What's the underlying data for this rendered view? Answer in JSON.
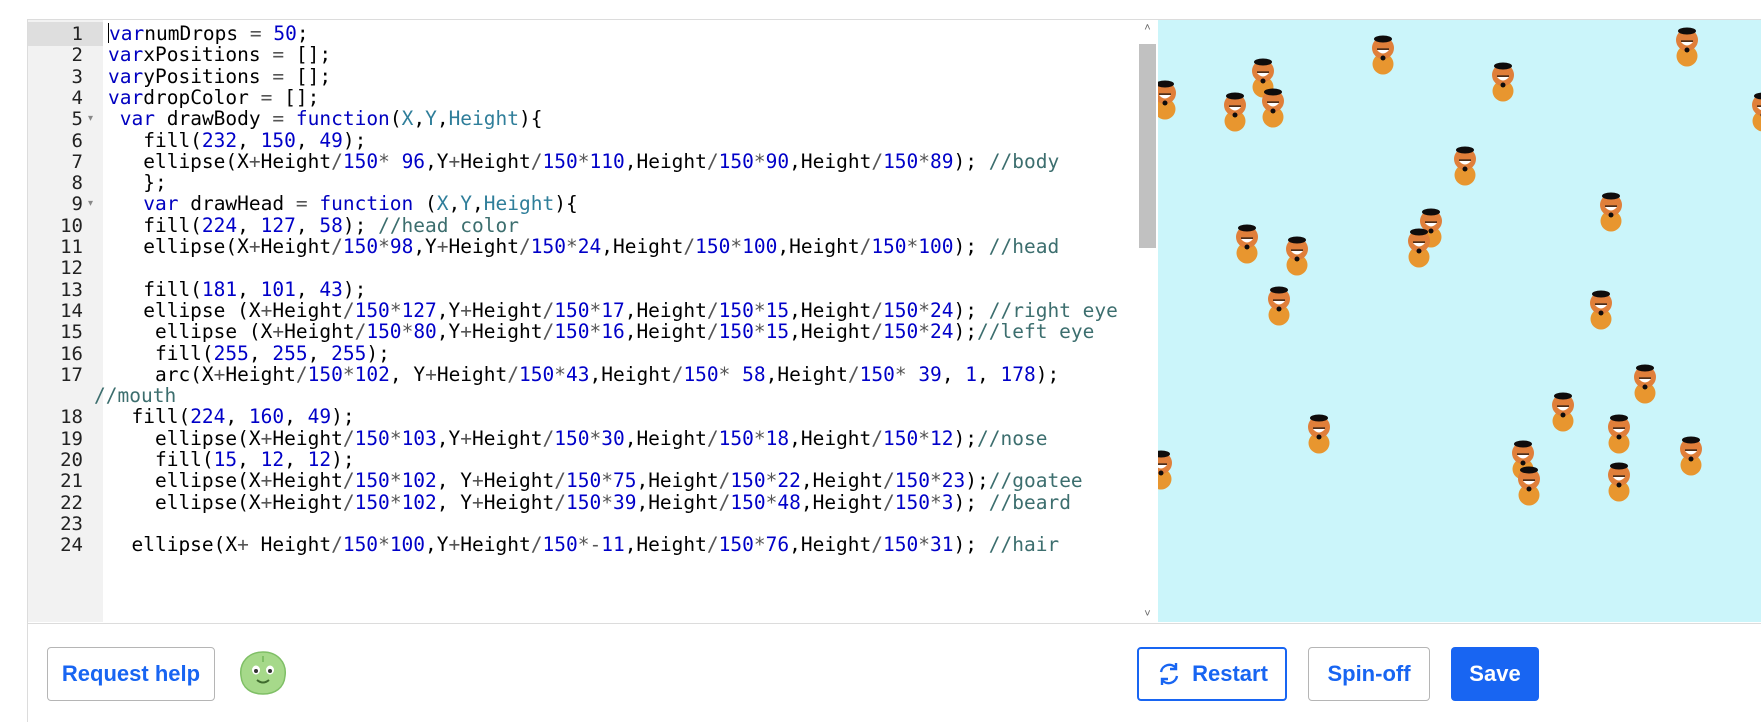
{
  "editor": {
    "line_numbers": [
      "1",
      "2",
      "3",
      "4",
      "5",
      "6",
      "7",
      "8",
      "9",
      "10",
      "11",
      "12",
      "13",
      "14",
      "15",
      "16",
      "17",
      "18",
      "19",
      "20",
      "21",
      "22",
      "23",
      "24"
    ],
    "lines": [
      [
        [
          "kw",
          "var"
        ],
        [
          "",
          "numDrops "
        ],
        [
          "op",
          "="
        ],
        [
          "num",
          " 50"
        ],
        [
          "",
          ";"
        ]
      ],
      [
        [
          "kw",
          "var"
        ],
        [
          "",
          "xPositions "
        ],
        [
          "op",
          "="
        ],
        [
          "",
          " [];"
        ]
      ],
      [
        [
          "kw",
          "var"
        ],
        [
          "",
          "yPositions "
        ],
        [
          "op",
          "="
        ],
        [
          "",
          " [];"
        ]
      ],
      [
        [
          "kw",
          "var"
        ],
        [
          "",
          "dropColor "
        ],
        [
          "op",
          "="
        ],
        [
          "",
          " [];"
        ]
      ],
      [
        [
          "",
          " "
        ],
        [
          "kw",
          "var"
        ],
        [
          "",
          " drawBody "
        ],
        [
          "op",
          "="
        ],
        [
          "kw",
          " function"
        ],
        [
          "",
          "("
        ],
        [
          "param",
          "X"
        ],
        [
          "",
          ","
        ],
        [
          "param",
          "Y"
        ],
        [
          "",
          ","
        ],
        [
          "param",
          "Height"
        ],
        [
          "",
          "){"
        ]
      ],
      [
        [
          "",
          "   fill("
        ],
        [
          "num",
          "232"
        ],
        [
          "",
          ", "
        ],
        [
          "num",
          "150"
        ],
        [
          "",
          ", "
        ],
        [
          "num",
          "49"
        ],
        [
          "",
          ");"
        ]
      ],
      [
        [
          "",
          "   ellipse(X"
        ],
        [
          "op",
          "+"
        ],
        [
          "",
          "Height"
        ],
        [
          "op",
          "/"
        ],
        [
          "num",
          "150"
        ],
        [
          "op",
          "*"
        ],
        [
          "num",
          " 96"
        ],
        [
          "",
          ",Y"
        ],
        [
          "op",
          "+"
        ],
        [
          "",
          "Height"
        ],
        [
          "op",
          "/"
        ],
        [
          "num",
          "150"
        ],
        [
          "op",
          "*"
        ],
        [
          "num",
          "110"
        ],
        [
          "",
          ",Height"
        ],
        [
          "op",
          "/"
        ],
        [
          "num",
          "150"
        ],
        [
          "op",
          "*"
        ],
        [
          "num",
          "90"
        ],
        [
          "",
          ",Height"
        ],
        [
          "op",
          "/"
        ],
        [
          "num",
          "150"
        ],
        [
          "op",
          "*"
        ],
        [
          "num",
          "89"
        ],
        [
          "",
          "); "
        ],
        [
          "cm",
          "//body"
        ]
      ],
      [
        [
          "",
          "   };"
        ]
      ],
      [
        [
          "",
          "   "
        ],
        [
          "kw",
          "var"
        ],
        [
          "",
          " drawHead "
        ],
        [
          "op",
          "="
        ],
        [
          "kw",
          " function"
        ],
        [
          "",
          " ("
        ],
        [
          "param",
          "X"
        ],
        [
          "",
          ","
        ],
        [
          "param",
          "Y"
        ],
        [
          "",
          ","
        ],
        [
          "param",
          "Height"
        ],
        [
          "",
          "){"
        ]
      ],
      [
        [
          "",
          "   fill("
        ],
        [
          "num",
          "224"
        ],
        [
          "",
          ", "
        ],
        [
          "num",
          "127"
        ],
        [
          "",
          ", "
        ],
        [
          "num",
          "58"
        ],
        [
          "",
          "); "
        ],
        [
          "cm",
          "//head color"
        ]
      ],
      [
        [
          "",
          "   ellipse(X"
        ],
        [
          "op",
          "+"
        ],
        [
          "",
          "Height"
        ],
        [
          "op",
          "/"
        ],
        [
          "num",
          "150"
        ],
        [
          "op",
          "*"
        ],
        [
          "num",
          "98"
        ],
        [
          "",
          ",Y"
        ],
        [
          "op",
          "+"
        ],
        [
          "",
          "Height"
        ],
        [
          "op",
          "/"
        ],
        [
          "num",
          "150"
        ],
        [
          "op",
          "*"
        ],
        [
          "num",
          "24"
        ],
        [
          "",
          ",Height"
        ],
        [
          "op",
          "/"
        ],
        [
          "num",
          "150"
        ],
        [
          "op",
          "*"
        ],
        [
          "num",
          "100"
        ],
        [
          "",
          ",Height"
        ],
        [
          "op",
          "/"
        ],
        [
          "num",
          "150"
        ],
        [
          "op",
          "*"
        ],
        [
          "num",
          "100"
        ],
        [
          "",
          "); "
        ],
        [
          "cm",
          "//head"
        ]
      ],
      [],
      [
        [
          "",
          "   fill("
        ],
        [
          "num",
          "181"
        ],
        [
          "",
          ", "
        ],
        [
          "num",
          "101"
        ],
        [
          "",
          ", "
        ],
        [
          "num",
          "43"
        ],
        [
          "",
          ");"
        ]
      ],
      [
        [
          "",
          "   ellipse (X"
        ],
        [
          "op",
          "+"
        ],
        [
          "",
          "Height"
        ],
        [
          "op",
          "/"
        ],
        [
          "num",
          "150"
        ],
        [
          "op",
          "*"
        ],
        [
          "num",
          "127"
        ],
        [
          "",
          ",Y"
        ],
        [
          "op",
          "+"
        ],
        [
          "",
          "Height"
        ],
        [
          "op",
          "/"
        ],
        [
          "num",
          "150"
        ],
        [
          "op",
          "*"
        ],
        [
          "num",
          "17"
        ],
        [
          "",
          ",Height"
        ],
        [
          "op",
          "/"
        ],
        [
          "num",
          "150"
        ],
        [
          "op",
          "*"
        ],
        [
          "num",
          "15"
        ],
        [
          "",
          ",Height"
        ],
        [
          "op",
          "/"
        ],
        [
          "num",
          "150"
        ],
        [
          "op",
          "*"
        ],
        [
          "num",
          "24"
        ],
        [
          "",
          "); "
        ],
        [
          "cm",
          "//right eye"
        ]
      ],
      [
        [
          "",
          "    ellipse (X"
        ],
        [
          "op",
          "+"
        ],
        [
          "",
          "Height"
        ],
        [
          "op",
          "/"
        ],
        [
          "num",
          "150"
        ],
        [
          "op",
          "*"
        ],
        [
          "num",
          "80"
        ],
        [
          "",
          ",Y"
        ],
        [
          "op",
          "+"
        ],
        [
          "",
          "Height"
        ],
        [
          "op",
          "/"
        ],
        [
          "num",
          "150"
        ],
        [
          "op",
          "*"
        ],
        [
          "num",
          "16"
        ],
        [
          "",
          ",Height"
        ],
        [
          "op",
          "/"
        ],
        [
          "num",
          "150"
        ],
        [
          "op",
          "*"
        ],
        [
          "num",
          "15"
        ],
        [
          "",
          ",Height"
        ],
        [
          "op",
          "/"
        ],
        [
          "num",
          "150"
        ],
        [
          "op",
          "*"
        ],
        [
          "num",
          "24"
        ],
        [
          "",
          ");"
        ],
        [
          "cm",
          "//left eye"
        ]
      ],
      [
        [
          "",
          "    fill("
        ],
        [
          "num",
          "255"
        ],
        [
          "",
          ", "
        ],
        [
          "num",
          "255"
        ],
        [
          "",
          ", "
        ],
        [
          "num",
          "255"
        ],
        [
          "",
          ");"
        ]
      ],
      [
        [
          "",
          "    arc(X"
        ],
        [
          "op",
          "+"
        ],
        [
          "",
          "Height"
        ],
        [
          "op",
          "/"
        ],
        [
          "num",
          "150"
        ],
        [
          "op",
          "*"
        ],
        [
          "num",
          "102"
        ],
        [
          "",
          ", Y"
        ],
        [
          "op",
          "+"
        ],
        [
          "",
          "Height"
        ],
        [
          "op",
          "/"
        ],
        [
          "num",
          "150"
        ],
        [
          "op",
          "*"
        ],
        [
          "num",
          "43"
        ],
        [
          "",
          ",Height"
        ],
        [
          "op",
          "/"
        ],
        [
          "num",
          "150"
        ],
        [
          "op",
          "*"
        ],
        [
          "num",
          " 58"
        ],
        [
          "",
          ",Height"
        ],
        [
          "op",
          "/"
        ],
        [
          "num",
          "150"
        ],
        [
          "op",
          "*"
        ],
        [
          "num",
          " 39"
        ],
        [
          "",
          ", "
        ],
        [
          "num",
          "1"
        ],
        [
          "",
          ", "
        ],
        [
          "num",
          "178"
        ],
        [
          "",
          ");"
        ]
      ],
      [
        [
          "",
          "  fill("
        ],
        [
          "num",
          "224"
        ],
        [
          "",
          ", "
        ],
        [
          "num",
          "160"
        ],
        [
          "",
          ", "
        ],
        [
          "num",
          "49"
        ],
        [
          "",
          ");"
        ]
      ],
      [
        [
          "",
          "    ellipse(X"
        ],
        [
          "op",
          "+"
        ],
        [
          "",
          "Height"
        ],
        [
          "op",
          "/"
        ],
        [
          "num",
          "150"
        ],
        [
          "op",
          "*"
        ],
        [
          "num",
          "103"
        ],
        [
          "",
          ",Y"
        ],
        [
          "op",
          "+"
        ],
        [
          "",
          "Height"
        ],
        [
          "op",
          "/"
        ],
        [
          "num",
          "150"
        ],
        [
          "op",
          "*"
        ],
        [
          "num",
          "30"
        ],
        [
          "",
          ",Height"
        ],
        [
          "op",
          "/"
        ],
        [
          "num",
          "150"
        ],
        [
          "op",
          "*"
        ],
        [
          "num",
          "18"
        ],
        [
          "",
          ",Height"
        ],
        [
          "op",
          "/"
        ],
        [
          "num",
          "150"
        ],
        [
          "op",
          "*"
        ],
        [
          "num",
          "12"
        ],
        [
          "",
          ");"
        ],
        [
          "cm",
          "//nose"
        ]
      ],
      [
        [
          "",
          "    fill("
        ],
        [
          "num",
          "15"
        ],
        [
          "",
          ", "
        ],
        [
          "num",
          "12"
        ],
        [
          "",
          ", "
        ],
        [
          "num",
          "12"
        ],
        [
          "",
          ");"
        ]
      ],
      [
        [
          "",
          "    ellipse(X"
        ],
        [
          "op",
          "+"
        ],
        [
          "",
          "Height"
        ],
        [
          "op",
          "/"
        ],
        [
          "num",
          "150"
        ],
        [
          "op",
          "*"
        ],
        [
          "num",
          "102"
        ],
        [
          "",
          ", Y"
        ],
        [
          "op",
          "+"
        ],
        [
          "",
          "Height"
        ],
        [
          "op",
          "/"
        ],
        [
          "num",
          "150"
        ],
        [
          "op",
          "*"
        ],
        [
          "num",
          "75"
        ],
        [
          "",
          ",Height"
        ],
        [
          "op",
          "/"
        ],
        [
          "num",
          "150"
        ],
        [
          "op",
          "*"
        ],
        [
          "num",
          "22"
        ],
        [
          "",
          ",Height"
        ],
        [
          "op",
          "/"
        ],
        [
          "num",
          "150"
        ],
        [
          "op",
          "*"
        ],
        [
          "num",
          "23"
        ],
        [
          "",
          ");"
        ],
        [
          "cm",
          "//goatee"
        ]
      ],
      [
        [
          "",
          "    ellipse(X"
        ],
        [
          "op",
          "+"
        ],
        [
          "",
          "Height"
        ],
        [
          "op",
          "/"
        ],
        [
          "num",
          "150"
        ],
        [
          "op",
          "*"
        ],
        [
          "num",
          "102"
        ],
        [
          "",
          ", Y"
        ],
        [
          "op",
          "+"
        ],
        [
          "",
          "Height"
        ],
        [
          "op",
          "/"
        ],
        [
          "num",
          "150"
        ],
        [
          "op",
          "*"
        ],
        [
          "num",
          "39"
        ],
        [
          "",
          ",Height"
        ],
        [
          "op",
          "/"
        ],
        [
          "num",
          "150"
        ],
        [
          "op",
          "*"
        ],
        [
          "num",
          "48"
        ],
        [
          "",
          ",Height"
        ],
        [
          "op",
          "/"
        ],
        [
          "num",
          "150"
        ],
        [
          "op",
          "*"
        ],
        [
          "num",
          "3"
        ],
        [
          "",
          "); "
        ],
        [
          "cm",
          "//beard"
        ]
      ],
      [],
      [
        [
          "",
          "  ellipse(X"
        ],
        [
          "op",
          "+"
        ],
        [
          "",
          " Height"
        ],
        [
          "op",
          "/"
        ],
        [
          "num",
          "150"
        ],
        [
          "op",
          "*"
        ],
        [
          "num",
          "100"
        ],
        [
          "",
          ",Y"
        ],
        [
          "op",
          "+"
        ],
        [
          "",
          "Height"
        ],
        [
          "op",
          "/"
        ],
        [
          "num",
          "150"
        ],
        [
          "op",
          "*-"
        ],
        [
          "num",
          "11"
        ],
        [
          "",
          ",Height"
        ],
        [
          "op",
          "/"
        ],
        [
          "num",
          "150"
        ],
        [
          "op",
          "*"
        ],
        [
          "num",
          "76"
        ],
        [
          "",
          ",Height"
        ],
        [
          "op",
          "/"
        ],
        [
          "num",
          "150"
        ],
        [
          "op",
          "*"
        ],
        [
          "num",
          "31"
        ],
        [
          "",
          "); "
        ],
        [
          "cm",
          "//hair"
        ]
      ]
    ],
    "wrapped_comment": "//mouth",
    "fold_markers": [
      "▾",
      "▾"
    ]
  },
  "canvas": {
    "background": "#cbf5fa",
    "figure_colors": {
      "body": "#e8962f",
      "head": "#e07f3a",
      "hair": "#0f0c0c",
      "mouth": "#ffffff"
    }
  },
  "buttons": {
    "request_help": "Request help",
    "restart": "Restart",
    "spin_off": "Spin-off",
    "save": "Save"
  },
  "icons": {
    "avatar": "green-blob-avatar-icon",
    "restart": "refresh-icon"
  }
}
